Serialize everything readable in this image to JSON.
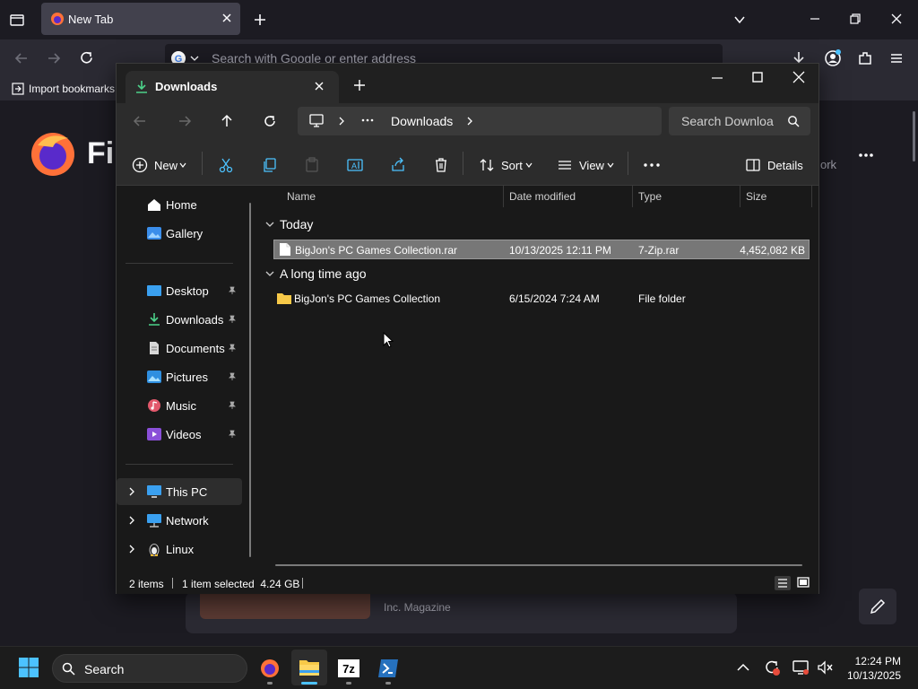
{
  "browser": {
    "tab_title": "New Tab",
    "url_placeholder": "Search with Google or enter address",
    "bookmarks_label": "Import bookmarks",
    "wordmark": "Fir",
    "card_source": "Inc. Magazine",
    "partial_work_text": "ork"
  },
  "explorer": {
    "tab_title": "Downloads",
    "address": {
      "breadcrumb": "Downloads"
    },
    "search_placeholder": "Search Downloa",
    "commands": {
      "new": "New",
      "sort": "Sort",
      "view": "View",
      "details": "Details"
    },
    "nav": {
      "home": "Home",
      "gallery": "Gallery",
      "desktop": "Desktop",
      "downloads": "Downloads",
      "documents": "Documents",
      "pictures": "Pictures",
      "music": "Music",
      "videos": "Videos",
      "this_pc": "This PC",
      "network": "Network",
      "linux": "Linux"
    },
    "columns": {
      "name": "Name",
      "date": "Date modified",
      "type": "Type",
      "size": "Size"
    },
    "groups": [
      {
        "title": "Today",
        "files": [
          {
            "name": "BigJon's PC Games Collection.rar",
            "date": "10/13/2025 12:11 PM",
            "type": "7-Zip.rar",
            "size": "4,452,082 KB",
            "selected": true
          }
        ]
      },
      {
        "title": "A long time ago",
        "files": [
          {
            "name": "BigJon's PC Games Collection",
            "date": "6/15/2024 7:24 AM",
            "type": "File folder",
            "size": "",
            "selected": false
          }
        ]
      }
    ],
    "status": {
      "count": "2 items",
      "selection": "1 item selected  4.24 GB"
    }
  },
  "taskbar": {
    "search_label": "Search",
    "time": "12:24 PM",
    "date": "10/13/2025",
    "apps": [
      "firefox-icon",
      "file-explorer-icon",
      "7zip-icon",
      "powershell-icon"
    ]
  },
  "colors": {
    "accent": "#4cc2ff",
    "folder": "#f7c948",
    "firefox_bg": "#1c1b22",
    "explorer_bg": "#191919"
  }
}
